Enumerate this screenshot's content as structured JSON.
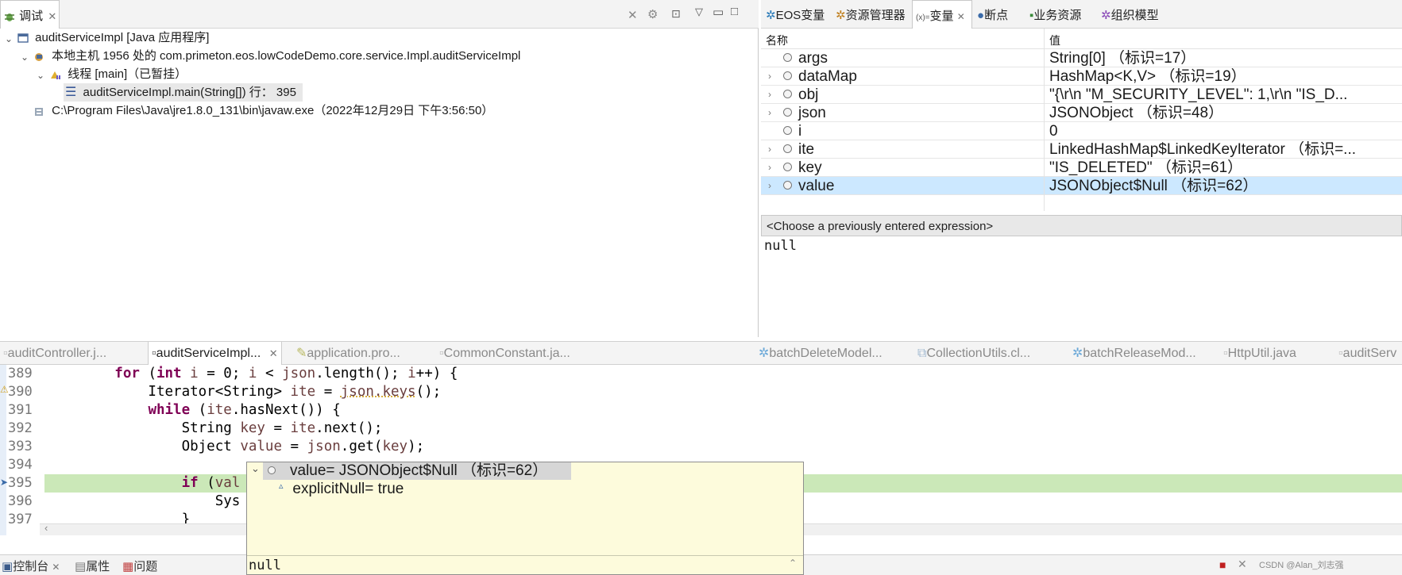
{
  "debug_view": {
    "tab_label": "调试",
    "tree": [
      {
        "label": "auditServiceImpl [Java 应用程序]"
      },
      {
        "label": "本地主机 1956 处的 com.primeton.eos.lowCodeDemo.core.service.Impl.auditServiceImpl"
      },
      {
        "label": "线程 [main]（已暂挂）"
      },
      {
        "label": "auditServiceImpl.main(String[]) 行：  395"
      },
      {
        "label": "C:\\Program Files\\Java\\jre1.8.0_131\\bin\\javaw.exe（2022年12月29日 下午3:56:50）"
      }
    ]
  },
  "right_tabs": [
    "EOS变量",
    "资源管理器",
    "变量",
    "断点",
    "业务资源",
    "组织模型"
  ],
  "variables": {
    "col_name": "名称",
    "col_value": "值",
    "rows": [
      {
        "name": "args",
        "value": "String[0]   （标识=17）"
      },
      {
        "name": "dataMap",
        "value": "HashMap<K,V>   （标识=19）"
      },
      {
        "name": "obj",
        "value": "\"{\\r\\n    \"M_SECURITY_LEVEL\": 1,\\r\\n    \"IS_D..."
      },
      {
        "name": "json",
        "value": "JSONObject   （标识=48）"
      },
      {
        "name": "i",
        "value": "0"
      },
      {
        "name": "ite",
        "value": "LinkedHashMap$LinkedKeyIterator   （标识=..."
      },
      {
        "name": "key",
        "value": "\"IS_DELETED\"  （标识=61）"
      },
      {
        "name": "value",
        "value": "JSONObject$Null   （标识=62）"
      }
    ],
    "expression_placeholder": "<Choose a previously entered expression>",
    "detail_value": "null"
  },
  "editor_tabs": [
    "auditController.j...",
    "auditServiceImpl...",
    "application.pro...",
    "CommonConstant.ja...",
    "batchDeleteModel...",
    "CollectionUtils.cl...",
    "batchReleaseMod...",
    "HttpUtil.java",
    "auditServ"
  ],
  "code": {
    "lines": [
      {
        "num": "389"
      },
      {
        "num": "390"
      },
      {
        "num": "391"
      },
      {
        "num": "392"
      },
      {
        "num": "393"
      },
      {
        "num": "394"
      },
      {
        "num": "395"
      },
      {
        "num": "396"
      },
      {
        "num": "397"
      }
    ]
  },
  "hover": {
    "root_label": "value= JSONObject$Null   （标识=62）",
    "child_label": "explicitNull= true",
    "detail": "null"
  },
  "bottom_tabs": [
    "控制台",
    "属性",
    "问题"
  ],
  "watermark": "CSDN @Alan_刘志强"
}
